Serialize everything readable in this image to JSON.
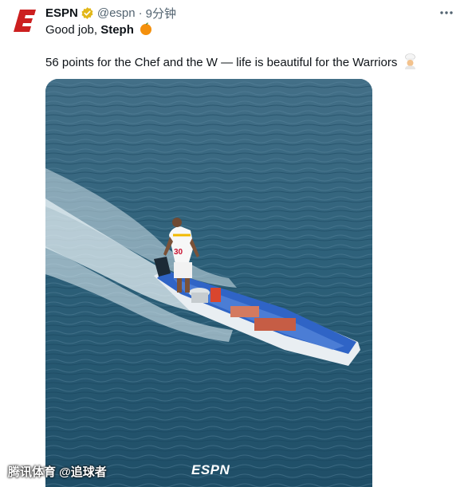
{
  "tweet": {
    "author_name": "ESPN",
    "handle": "@espn",
    "separator": "·",
    "timestamp": "9分钟",
    "text_line1_prefix": "Good job, ",
    "text_line1_bold": "Steph",
    "text_line1_emoji": "orange-emoji",
    "text_line2": "56 points for the Chef and the W — life is beautiful for the Warriors",
    "text_line2_emoji": "chef-emoji",
    "verified": true
  },
  "media": {
    "jersey_number": "30",
    "logo_text": "ESPN"
  },
  "watermark": {
    "text": "腾讯体育 @追球者"
  },
  "colors": {
    "brand_red": "#cc1f1f",
    "verified_gold": "#e2b719",
    "text_primary": "#0f1419",
    "text_secondary": "#536471",
    "water": "#2a5c76",
    "boat_hull": "#e9eef2",
    "boat_interior": "#2f64c6"
  },
  "icons": [
    "espn-logo-icon",
    "verified-badge-icon",
    "more-options-icon",
    "orange-emoji-icon",
    "chef-emoji-icon"
  ]
}
